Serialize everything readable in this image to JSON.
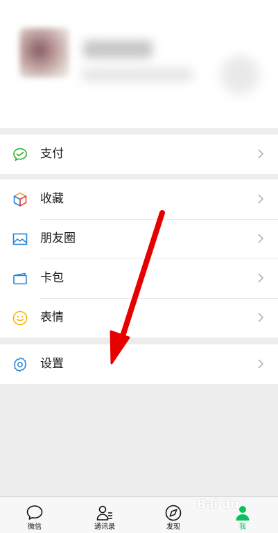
{
  "menu": {
    "pay": {
      "label": "支付",
      "icon": "wechat-pay-icon"
    },
    "favorites": {
      "label": "收藏",
      "icon": "favorites-cube-icon"
    },
    "moments": {
      "label": "朋友圈",
      "icon": "moments-image-icon"
    },
    "cards": {
      "label": "卡包",
      "icon": "card-wallet-icon"
    },
    "stickers": {
      "label": "表情",
      "icon": "smiley-icon"
    },
    "settings": {
      "label": "设置",
      "icon": "gear-icon"
    }
  },
  "tabbar": {
    "chats": "微信",
    "contacts": "通讯录",
    "discover": "发现",
    "me": "我"
  },
  "watermark": "Bai du",
  "colors": {
    "accent": "#07c160",
    "annotation_arrow": "#e60000",
    "background": "#ededed"
  }
}
